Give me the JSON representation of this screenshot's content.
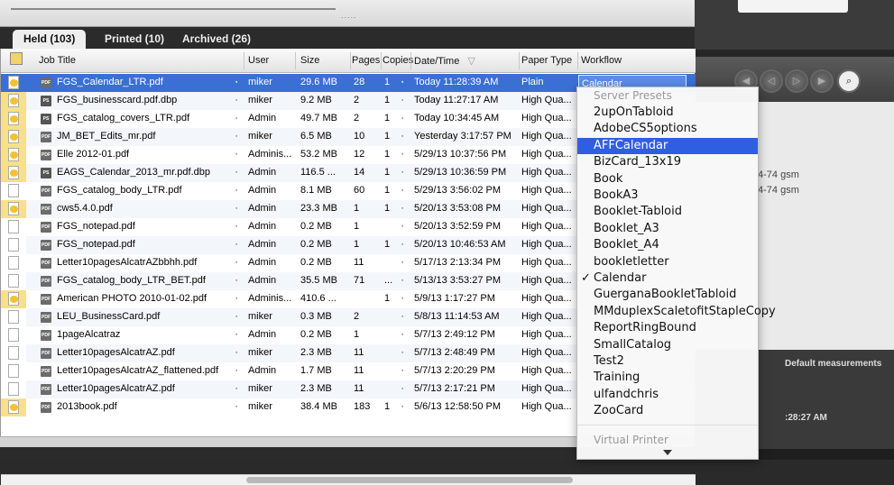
{
  "tabs": [
    {
      "label": "Held (103)",
      "active": true
    },
    {
      "label": "Printed (10)",
      "active": false
    },
    {
      "label": "Archived (26)",
      "active": false
    }
  ],
  "topbar": {
    "grip": "....."
  },
  "columns": [
    "Job Title",
    "User",
    "Size",
    "Pages",
    "Copies",
    "Date/Time",
    "Paper Type",
    "Workflow"
  ],
  "rows": [
    {
      "title": "FGS_Calendar_LTR.pdf",
      "user": "miker",
      "size": "29.6 MB",
      "pages": "28",
      "copies": "1",
      "date": "Today 11:28:39 AM",
      "paper": "Plain",
      "workflow": "Calendar",
      "icon": "pdf",
      "badge": true,
      "selected": true
    },
    {
      "title": "FGS_businesscard.pdf.dbp",
      "user": "miker",
      "size": "9.2 MB",
      "pages": "2",
      "copies": "1",
      "date": "Today 11:27:17 AM",
      "paper": "High Qua...",
      "workflow": "",
      "icon": "ps",
      "badge": true
    },
    {
      "title": "FGS_catalog_covers_LTR.pdf",
      "user": "Admin",
      "size": "49.7 MB",
      "pages": "2",
      "copies": "1",
      "date": "Today 10:34:45 AM",
      "paper": "High Qua...",
      "workflow": "",
      "icon": "ps",
      "badge": true
    },
    {
      "title": "JM_BET_Edits_mr.pdf",
      "user": "miker",
      "size": "6.5 MB",
      "pages": "10",
      "copies": "1",
      "date": "Yesterday 3:17:57 PM",
      "paper": "High Qua...",
      "workflow": "",
      "icon": "pdf",
      "badge": true
    },
    {
      "title": "Elle 2012-01.pdf",
      "user": "Adminis...",
      "size": "53.2 MB",
      "pages": "12",
      "copies": "1",
      "date": "5/29/13 10:37:56 PM",
      "paper": "High Qua...",
      "workflow": "",
      "icon": "pdf",
      "badge": true
    },
    {
      "title": "EAGS_Calendar_2013_mr.pdf.dbp",
      "user": "Admin",
      "size": "116.5 ...",
      "pages": "14",
      "copies": "1",
      "date": "5/29/13 10:36:59 PM",
      "paper": "High Qua...",
      "workflow": "",
      "icon": "ps",
      "badge": true
    },
    {
      "title": "FGS_catalog_body_LTR.pdf",
      "user": "Admin",
      "size": "8.1 MB",
      "pages": "60",
      "copies": "1",
      "date": "5/29/13 3:56:02 PM",
      "paper": "High Qua...",
      "workflow": "",
      "icon": "pdf",
      "badge": false
    },
    {
      "title": "cws5.4.0.pdf",
      "user": "Admin",
      "size": "23.3 MB",
      "pages": "1",
      "copies": "1",
      "date": "5/20/13 3:53:08 PM",
      "paper": "High Qua...",
      "workflow": "",
      "icon": "pdf",
      "badge": true
    },
    {
      "title": "FGS_notepad.pdf",
      "user": "Admin",
      "size": "0.2 MB",
      "pages": "1",
      "copies": "",
      "date": "5/20/13 3:52:59 PM",
      "paper": "High Qua...",
      "workflow": "",
      "icon": "pdf",
      "badge": false
    },
    {
      "title": "FGS_notepad.pdf",
      "user": "Admin",
      "size": "0.2 MB",
      "pages": "1",
      "copies": "1",
      "date": "5/20/13 10:46:53 AM",
      "paper": "High Qua...",
      "workflow": "",
      "icon": "pdf",
      "badge": false
    },
    {
      "title": "Letter10pagesAlcatrAZbbhh.pdf",
      "user": "Admin",
      "size": "0.2 MB",
      "pages": "11",
      "copies": "",
      "date": "5/17/13 2:13:34 PM",
      "paper": "High Qua...",
      "workflow": "",
      "icon": "pdf",
      "badge": false
    },
    {
      "title": "FGS_catalog_body_LTR_BET.pdf",
      "user": "Admin",
      "size": "35.5 MB",
      "pages": "71",
      "copies": "...",
      "date": "5/13/13 3:53:27 PM",
      "paper": "High Qua...",
      "workflow": "",
      "icon": "pdf",
      "badge": false
    },
    {
      "title": "American PHOTO 2010-01-02.pdf",
      "user": "Adminis...",
      "size": "410.6 ...",
      "pages": "",
      "copies": "1",
      "date": "5/9/13 1:17:27 PM",
      "paper": "High Qua...",
      "workflow": "",
      "icon": "pdf",
      "badge": true
    },
    {
      "title": "LEU_BusinessCard.pdf",
      "user": "miker",
      "size": "0.3 MB",
      "pages": "2",
      "copies": "",
      "date": "5/8/13 11:14:53 AM",
      "paper": "High Qua...",
      "workflow": "",
      "icon": "pdf",
      "badge": false
    },
    {
      "title": "1pageAlcatraz",
      "user": "Admin",
      "size": "0.2 MB",
      "pages": "1",
      "copies": "",
      "date": "5/7/13 2:49:12 PM",
      "paper": "High Qua...",
      "workflow": "",
      "icon": "pdf",
      "badge": false
    },
    {
      "title": "Letter10pagesAlcatrAZ.pdf",
      "user": "miker",
      "size": "2.3 MB",
      "pages": "11",
      "copies": "",
      "date": "5/7/13 2:48:49 PM",
      "paper": "High Qua...",
      "workflow": "",
      "icon": "pdf",
      "badge": false
    },
    {
      "title": "Letter10pagesAlcatrAZ_flattened.pdf",
      "user": "Admin",
      "size": "1.7 MB",
      "pages": "11",
      "copies": "",
      "date": "5/7/13 2:20:29 PM",
      "paper": "High Qua...",
      "workflow": "",
      "icon": "pdf",
      "badge": false
    },
    {
      "title": "Letter10pagesAlcatrAZ.pdf",
      "user": "miker",
      "size": "2.3 MB",
      "pages": "11",
      "copies": "",
      "date": "5/7/13 2:17:21 PM",
      "paper": "High Qua...",
      "workflow": "",
      "icon": "pdf",
      "badge": false
    },
    {
      "title": "2013book.pdf",
      "user": "miker",
      "size": "38.4 MB",
      "pages": "183",
      "copies": "1",
      "date": "5/6/13 12:58:50 PM",
      "paper": "High Qua...",
      "workflow": "",
      "icon": "pdf",
      "badge": true
    }
  ],
  "icon_labels": {
    "pdf": "PDF",
    "ps": "PS"
  },
  "menu": {
    "header": "Server Presets",
    "items": [
      "2upOnTabloid",
      "AdobeCS5options",
      "AFFCalendar",
      "BizCard_13x19",
      "Book",
      "BookA3",
      "Booklet-Tabloid",
      "Booklet_A3",
      "Booklet_A4",
      "bookletletter",
      "Calendar",
      "GuerganaBookletTabloid",
      "MMduplexScaletofitStapleCopy",
      "ReportRingBound",
      "SmallCatalog",
      "Test2",
      "Training",
      "ulfandchris",
      "ZooCard"
    ],
    "highlighted": "AFFCalendar",
    "checked": "Calendar",
    "footer_header": "Virtual Printer"
  },
  "right_panel": {
    "gsm_1": "4-74 gsm",
    "gsm_2": "4-74 gsm",
    "default_measurements": "Default measurements",
    "time": ":28:27 AM"
  },
  "colors": {
    "selection": "#3a6fd4",
    "menu_highlight": "#2f5fe1",
    "badge": "#f1c232"
  }
}
